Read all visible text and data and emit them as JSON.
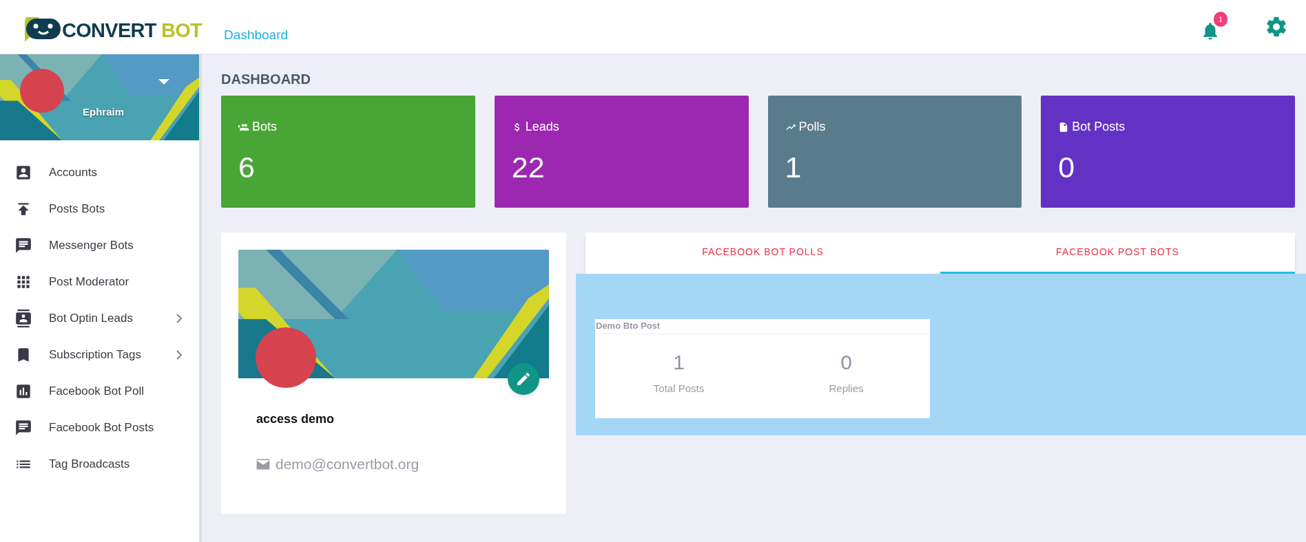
{
  "header": {
    "logo": {
      "word_1": "CONVERT",
      "word_2": "BOT"
    },
    "breadcrumb": "Dashboard",
    "notifications": {
      "count": "1"
    }
  },
  "sidebar": {
    "user": {
      "name": "Ephraim"
    },
    "items": [
      {
        "label": "Accounts",
        "kind": "account",
        "expandable": false
      },
      {
        "label": "Posts Bots",
        "kind": "upload",
        "expandable": false
      },
      {
        "label": "Messenger Bots",
        "kind": "message",
        "expandable": false
      },
      {
        "label": "Post Moderator",
        "kind": "grid",
        "expandable": false
      },
      {
        "label": "Bot Optin Leads",
        "kind": "contacts",
        "expandable": true
      },
      {
        "label": "Subscription Tags",
        "kind": "bookmark",
        "expandable": true
      },
      {
        "label": "Facebook Bot Poll",
        "kind": "chart",
        "expandable": false
      },
      {
        "label": "Facebook Bot Posts",
        "kind": "message",
        "expandable": false
      },
      {
        "label": "Tag Broadcasts",
        "kind": "list",
        "expandable": false
      }
    ]
  },
  "page_title": "DASHBOARD",
  "stats": [
    {
      "label": "Bots",
      "value": "6",
      "kind": "people",
      "color": "#4aa537"
    },
    {
      "label": "Leads",
      "value": "22",
      "kind": "dollar",
      "color": "#9c27b0"
    },
    {
      "label": "Polls",
      "value": "1",
      "kind": "trend",
      "color": "#5a7b8c"
    },
    {
      "label": "Bot Posts",
      "value": "0",
      "kind": "file",
      "color": "#6431c5"
    }
  ],
  "profile": {
    "name": "access demo",
    "email": "demo@convertbot.org"
  },
  "tabs": [
    {
      "label": "FACEBOOK BOT POLLS",
      "selected": false
    },
    {
      "label": "FACEBOOK POST BOTS",
      "selected": true
    }
  ],
  "post_cards": [
    {
      "title": "Demo Bto Post",
      "metrics": [
        {
          "value": "1",
          "label": "Total Posts"
        },
        {
          "value": "0",
          "label": "Replies"
        }
      ]
    }
  ]
}
